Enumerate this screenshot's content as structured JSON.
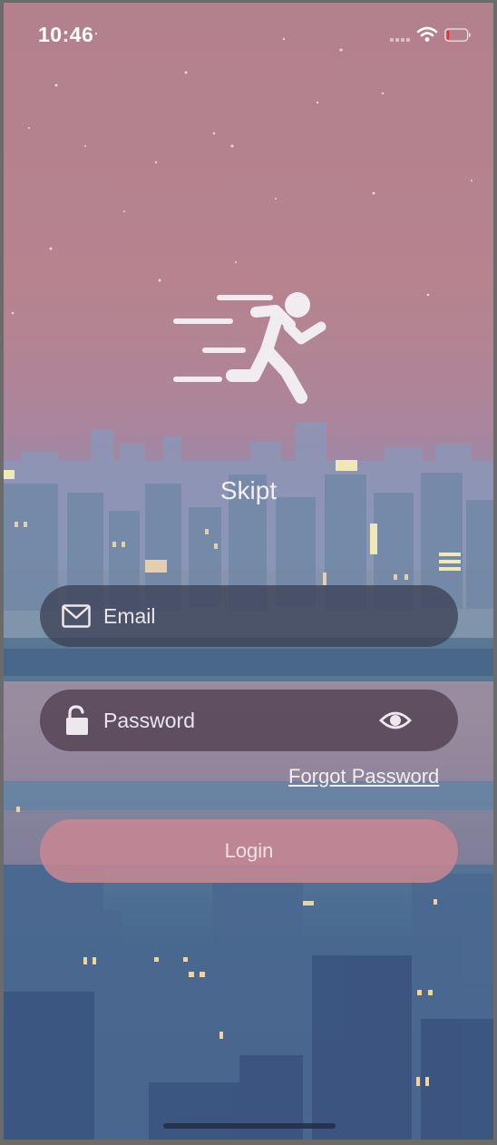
{
  "status_bar": {
    "time": "10:46"
  },
  "app": {
    "title": "Skipt"
  },
  "form": {
    "email_placeholder": "Email",
    "password_placeholder": "Password",
    "forgot_password": "Forgot Password",
    "login_label": "Login"
  },
  "icons": {
    "logo": "running-person-icon",
    "email": "envelope-icon",
    "password": "unlocked-padlock-icon",
    "toggle": "eye-icon"
  },
  "colors": {
    "sky_top": "#b3808e",
    "field_bg": "#373c50",
    "login_bg": "#c88794",
    "text": "#f2eef0"
  }
}
